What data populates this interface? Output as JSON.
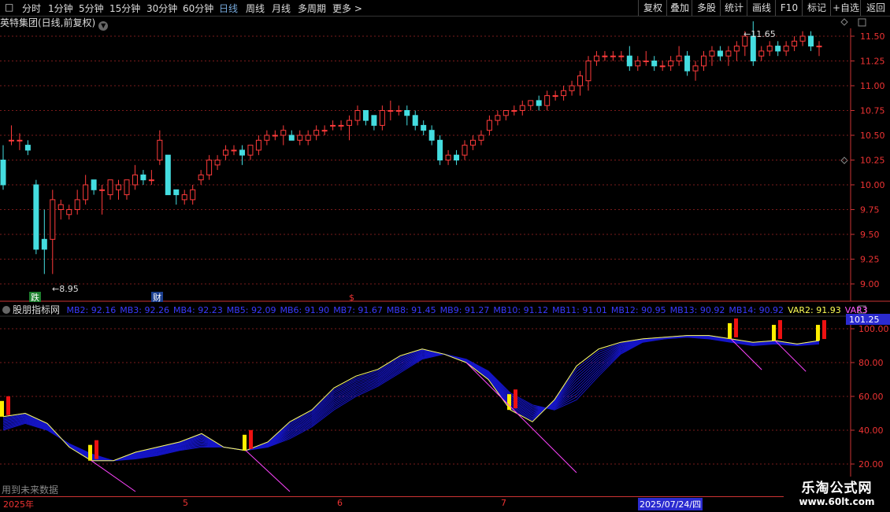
{
  "toolbar": {
    "periods": [
      "分时",
      "1分钟",
      "5分钟",
      "15分钟",
      "30分钟",
      "60分钟",
      "日线",
      "周线",
      "月线",
      "多周期",
      "更多 >"
    ],
    "active": "日线",
    "right_buttons": [
      "复权",
      "叠加",
      "多股",
      "统计",
      "画线",
      "F10",
      "标记",
      "+自选",
      "返回"
    ]
  },
  "title": "英特集团(日线,前复权)",
  "price_axis": {
    "ticks": [
      "11.50",
      "11.25",
      "11.00",
      "10.75",
      "10.50",
      "10.25",
      "10.00",
      "9.75",
      "9.50",
      "9.25",
      "9.00"
    ]
  },
  "annotations": {
    "high": "11.65",
    "low": "8.95",
    "event1": "跌",
    "event2": "财",
    "event3": "$"
  },
  "indicator": {
    "name": "股朋指标网",
    "values": [
      {
        "label": "MB2: 92.16",
        "color": "#3a3aff"
      },
      {
        "label": "MB3: 92.26",
        "color": "#3a3aff"
      },
      {
        "label": "MB4: 92.23",
        "color": "#3a3aff"
      },
      {
        "label": "MB5: 92.09",
        "color": "#3a3aff"
      },
      {
        "label": "MB6: 91.90",
        "color": "#3a3aff"
      },
      {
        "label": "MB7: 91.67",
        "color": "#3a3aff"
      },
      {
        "label": "MB8: 91.45",
        "color": "#3a3aff"
      },
      {
        "label": "MB9: 91.27",
        "color": "#3a3aff"
      },
      {
        "label": "MB10: 91.12",
        "color": "#3a3aff"
      },
      {
        "label": "MB11: 91.01",
        "color": "#3a3aff"
      },
      {
        "label": "MB12: 90.95",
        "color": "#3a3aff"
      },
      {
        "label": "MB13: 90.92",
        "color": "#3a3aff"
      },
      {
        "label": "MB14: 90.92",
        "color": "#3a3aff"
      },
      {
        "label": "VAR2: 91.93",
        "color": "#ffff55"
      },
      {
        "label": "VAR3",
        "color": "#ff55ff"
      }
    ],
    "current": "101.25",
    "ticks": [
      "100.00",
      "80.00",
      "60.00",
      "40.00",
      "20.00"
    ]
  },
  "footnote": "用到未来数据",
  "dates": {
    "year": "2025年",
    "m5": "5",
    "m6": "6",
    "m7": "7",
    "highlight": "2025/07/24/四"
  },
  "watermark": {
    "line1": "乐淘公式网",
    "line2": "www.60lt.com"
  },
  "chart_data": [
    {
      "type": "candlestick",
      "title": "英特集团(日线,前复权)",
      "ylim": [
        8.85,
        11.6
      ],
      "ohlc": [
        [
          10.25,
          10.4,
          9.95,
          10.0
        ],
        [
          10.45,
          10.6,
          10.4,
          10.45
        ],
        [
          10.45,
          10.52,
          10.35,
          10.45
        ],
        [
          10.4,
          10.45,
          10.3,
          10.35
        ],
        [
          10.0,
          10.05,
          9.3,
          9.35
        ],
        [
          9.45,
          9.75,
          9.1,
          9.35
        ],
        [
          9.45,
          9.95,
          9.1,
          9.85
        ],
        [
          9.75,
          9.85,
          9.65,
          9.8
        ],
        [
          9.7,
          9.8,
          9.65,
          9.75
        ],
        [
          9.75,
          9.95,
          9.7,
          9.85
        ],
        [
          9.85,
          10.1,
          9.8,
          10.0
        ],
        [
          10.05,
          10.05,
          9.9,
          9.95
        ],
        [
          9.95,
          10.0,
          9.7,
          9.95
        ],
        [
          9.9,
          10.05,
          9.85,
          10.05
        ],
        [
          9.95,
          10.05,
          9.85,
          10.0
        ],
        [
          9.9,
          10.05,
          9.85,
          10.05
        ],
        [
          10.0,
          10.2,
          9.95,
          10.1
        ],
        [
          10.1,
          10.15,
          10.0,
          10.05
        ],
        [
          10.05,
          10.15,
          10.0,
          10.05
        ],
        [
          10.25,
          10.55,
          10.2,
          10.45
        ],
        [
          10.3,
          10.3,
          9.9,
          9.9
        ],
        [
          9.95,
          9.95,
          9.8,
          9.9
        ],
        [
          9.85,
          9.95,
          9.8,
          9.9
        ],
        [
          9.85,
          10.0,
          9.8,
          9.95
        ],
        [
          10.05,
          10.15,
          10.0,
          10.1
        ],
        [
          10.1,
          10.3,
          10.05,
          10.25
        ],
        [
          10.2,
          10.3,
          10.15,
          10.25
        ],
        [
          10.3,
          10.4,
          10.25,
          10.35
        ],
        [
          10.35,
          10.4,
          10.3,
          10.35
        ],
        [
          10.35,
          10.4,
          10.2,
          10.3
        ],
        [
          10.3,
          10.4,
          10.25,
          10.4
        ],
        [
          10.35,
          10.5,
          10.3,
          10.45
        ],
        [
          10.45,
          10.55,
          10.4,
          10.5
        ],
        [
          10.5,
          10.55,
          10.45,
          10.5
        ],
        [
          10.5,
          10.6,
          10.4,
          10.55
        ],
        [
          10.5,
          10.55,
          10.45,
          10.45
        ],
        [
          10.45,
          10.55,
          10.4,
          10.5
        ],
        [
          10.45,
          10.55,
          10.4,
          10.5
        ],
        [
          10.5,
          10.6,
          10.45,
          10.55
        ],
        [
          10.55,
          10.6,
          10.5,
          10.55
        ],
        [
          10.6,
          10.65,
          10.55,
          10.6
        ],
        [
          10.6,
          10.65,
          10.55,
          10.6
        ],
        [
          10.6,
          10.7,
          10.45,
          10.65
        ],
        [
          10.65,
          10.8,
          10.6,
          10.75
        ],
        [
          10.75,
          10.75,
          10.6,
          10.65
        ],
        [
          10.7,
          10.7,
          10.55,
          10.6
        ],
        [
          10.6,
          10.8,
          10.55,
          10.75
        ],
        [
          10.75,
          10.85,
          10.65,
          10.75
        ],
        [
          10.75,
          10.8,
          10.7,
          10.75
        ],
        [
          10.75,
          10.8,
          10.6,
          10.7
        ],
        [
          10.7,
          10.75,
          10.55,
          10.6
        ],
        [
          10.6,
          10.65,
          10.5,
          10.55
        ],
        [
          10.55,
          10.6,
          10.4,
          10.45
        ],
        [
          10.45,
          10.5,
          10.2,
          10.25
        ],
        [
          10.25,
          10.35,
          10.2,
          10.3
        ],
        [
          10.3,
          10.35,
          10.2,
          10.25
        ],
        [
          10.3,
          10.45,
          10.25,
          10.4
        ],
        [
          10.4,
          10.5,
          10.35,
          10.45
        ],
        [
          10.45,
          10.55,
          10.4,
          10.5
        ],
        [
          10.55,
          10.7,
          10.5,
          10.65
        ],
        [
          10.65,
          10.75,
          10.6,
          10.7
        ],
        [
          10.7,
          10.75,
          10.65,
          10.75
        ],
        [
          10.75,
          10.8,
          10.7,
          10.75
        ],
        [
          10.75,
          10.85,
          10.7,
          10.8
        ],
        [
          10.8,
          10.85,
          10.75,
          10.85
        ],
        [
          10.85,
          10.9,
          10.75,
          10.8
        ],
        [
          10.8,
          10.95,
          10.75,
          10.9
        ],
        [
          10.9,
          10.95,
          10.85,
          10.9
        ],
        [
          10.9,
          11.0,
          10.85,
          10.95
        ],
        [
          10.95,
          11.05,
          10.9,
          11.0
        ],
        [
          11.0,
          11.15,
          10.9,
          11.1
        ],
        [
          11.05,
          11.3,
          10.95,
          11.25
        ],
        [
          11.25,
          11.35,
          11.2,
          11.3
        ],
        [
          11.3,
          11.35,
          11.25,
          11.3
        ],
        [
          11.3,
          11.35,
          11.25,
          11.3
        ],
        [
          11.3,
          11.35,
          11.25,
          11.3
        ],
        [
          11.3,
          11.4,
          11.15,
          11.2
        ],
        [
          11.2,
          11.3,
          11.15,
          11.25
        ],
        [
          11.25,
          11.35,
          11.2,
          11.25
        ],
        [
          11.25,
          11.3,
          11.15,
          11.2
        ],
        [
          11.2,
          11.25,
          11.15,
          11.2
        ],
        [
          11.2,
          11.3,
          11.15,
          11.25
        ],
        [
          11.25,
          11.4,
          11.2,
          11.3
        ],
        [
          11.3,
          11.35,
          11.1,
          11.15
        ],
        [
          11.15,
          11.25,
          11.05,
          11.2
        ],
        [
          11.2,
          11.35,
          11.15,
          11.3
        ],
        [
          11.3,
          11.4,
          11.2,
          11.35
        ],
        [
          11.35,
          11.4,
          11.25,
          11.3
        ],
        [
          11.3,
          11.4,
          11.2,
          11.35
        ],
        [
          11.35,
          11.45,
          11.25,
          11.4
        ],
        [
          11.4,
          11.55,
          11.3,
          11.5
        ],
        [
          11.5,
          11.65,
          11.2,
          11.25
        ],
        [
          11.3,
          11.4,
          11.25,
          11.35
        ],
        [
          11.35,
          11.45,
          11.3,
          11.4
        ],
        [
          11.4,
          11.45,
          11.3,
          11.35
        ],
        [
          11.35,
          11.45,
          11.3,
          11.4
        ],
        [
          11.4,
          11.5,
          11.35,
          11.45
        ],
        [
          11.45,
          11.55,
          11.4,
          11.5
        ],
        [
          11.5,
          11.55,
          11.35,
          11.4
        ],
        [
          11.4,
          11.45,
          11.3,
          11.4
        ]
      ]
    },
    {
      "type": "line",
      "title": "股朋指标网",
      "ylim": [
        15,
        103
      ],
      "series": [
        {
          "name": "VAR2",
          "values": [
            48,
            50,
            44,
            30,
            22,
            22,
            27,
            30,
            33,
            38,
            30,
            28,
            33,
            45,
            52,
            65,
            72,
            76,
            84,
            88,
            85,
            80,
            70,
            52,
            45,
            58,
            78,
            88,
            92,
            94,
            95,
            96,
            96,
            94,
            92,
            93,
            91,
            93
          ]
        },
        {
          "name": "MB14",
          "values": [
            40,
            44,
            40,
            32,
            26,
            22,
            23,
            25,
            28,
            30,
            30,
            28,
            30,
            35,
            42,
            52,
            60,
            66,
            74,
            82,
            85,
            82,
            75,
            62,
            55,
            52,
            58,
            72,
            85,
            92,
            94,
            95,
            94,
            92,
            90,
            91,
            90,
            91
          ]
        }
      ]
    }
  ]
}
